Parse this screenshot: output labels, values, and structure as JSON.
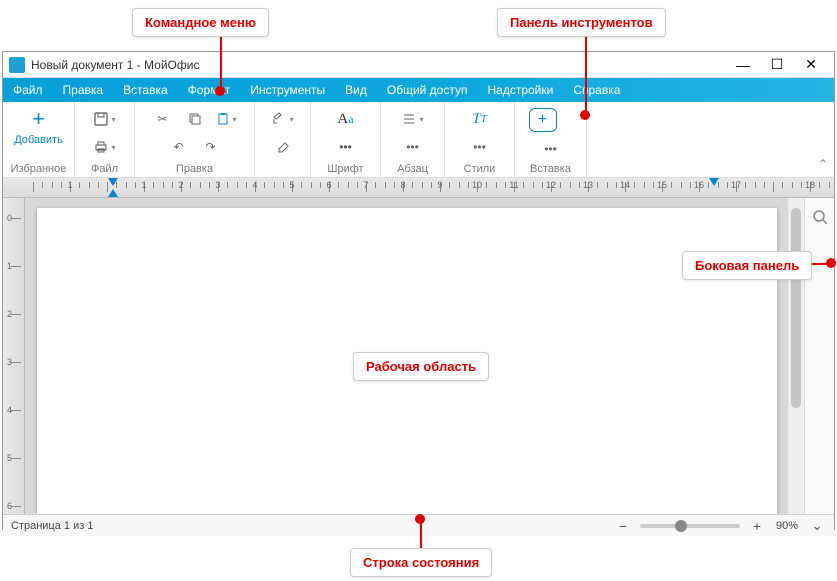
{
  "callouts": {
    "menu": "Командное меню",
    "toolbar": "Панель инструментов",
    "workarea": "Рабочая область",
    "sidebar": "Боковая панель",
    "statusbar": "Строка состояния"
  },
  "titlebar": {
    "title": "Новый документ 1 - МойОфис"
  },
  "menu": {
    "items": [
      "Файл",
      "Правка",
      "Вставка",
      "Формат",
      "Инструменты",
      "Вид",
      "Общий доступ",
      "Надстройки",
      "Справка"
    ]
  },
  "toolbar": {
    "favorites_label": "Избранное",
    "add_label": "Добавить",
    "groups": {
      "file": "Файл",
      "edit": "Правка",
      "font": "Шрифт",
      "paragraph": "Абзац",
      "styles": "Стили",
      "insert": "Вставка"
    },
    "more": "•••"
  },
  "ruler": {
    "h_numbers": [
      "",
      "1",
      "",
      "1",
      "2",
      "3",
      "4",
      "5",
      "6",
      "7",
      "8",
      "9",
      "10",
      "11",
      "12",
      "13",
      "14",
      "15",
      "16",
      "17",
      "",
      "18"
    ]
  },
  "statusbar": {
    "page_text": "Страница 1 из 1",
    "zoom": "90%"
  }
}
